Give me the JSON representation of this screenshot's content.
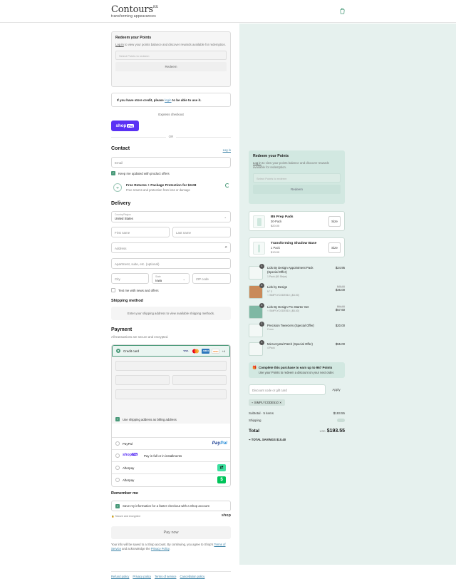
{
  "header": {
    "brand": "Contours",
    "brand_mark": "RX",
    "tagline": "transforming appearances"
  },
  "redeem": {
    "title": "Redeem your Points",
    "login_link": "Log in",
    "text": " to view your points balance and discover rewards available for redemption.",
    "placeholder": "Select Points to redeem",
    "button": "Redeem"
  },
  "store_credit": {
    "prefix": "If you have store credit, please ",
    "link": "login",
    "suffix": " to be able to use it."
  },
  "express": {
    "label": "Express checkout",
    "shop_pay": "shop",
    "shop_pay_badge": "Pay",
    "or": "OR"
  },
  "contact": {
    "heading": "Contact",
    "login": "Log in",
    "email_placeholder": "Email",
    "newsletter": "Keep me updated with product offers"
  },
  "protection": {
    "title": "Free Returns + Package Protection for $3.08",
    "subtitle": "Free returns and protection from loss or damage"
  },
  "delivery": {
    "heading": "Delivery",
    "country_label": "Country/Region",
    "country_value": "United States",
    "first_name": "First name",
    "last_name": "Last name",
    "address": "Address",
    "apartment": "Apartment, suite, etc. (optional)",
    "city": "City",
    "state_label": "State",
    "state_value": "Iowa",
    "zip": "ZIP code",
    "text_me": "Text me with news and offers"
  },
  "shipping": {
    "heading": "Shipping method",
    "note": "Enter your shipping address to view available shipping methods."
  },
  "payment": {
    "heading": "Payment",
    "sub": "All transactions are secure and encrypted.",
    "credit_card": "Credit card",
    "cards": [
      "VISA",
      "MC",
      "AMEX",
      "DISC"
    ],
    "more_cards": "+4",
    "billing": "Use shipping address as billing address",
    "methods": [
      {
        "label": "PayPal"
      },
      {
        "label": "Pay in full or in installments"
      },
      {
        "label": "Afterpay"
      },
      {
        "label": "Afterpay"
      }
    ],
    "paypal_a": "Pay",
    "paypal_b": "Pal",
    "shop_mini": "shop",
    "shop_mini_badge": "Pay"
  },
  "remember": {
    "heading": "Remember me",
    "label": "Save my information for a faster checkout with a Shop account",
    "secure": "Secure and encrypted",
    "shop": "shop"
  },
  "pay_now": "Pay now",
  "terms": {
    "text": "Your info will be saved to a Shop account. By continuing, you agree to Shop's ",
    "tos": "Terms of Service",
    "mid": " and acknowledge the ",
    "privacy": "Privacy Policy",
    "end": "."
  },
  "footer": [
    "Refund policy",
    "Privacy policy",
    "Terms of service",
    "Cancellation policy"
  ],
  "upsells": [
    {
      "name": "B5 Prep Pads",
      "variant": "30-Pack",
      "price": "$20.00",
      "button": "Size"
    },
    {
      "name": "Transforming Shadow Base",
      "variant": "1 Pack",
      "price": "$13.00",
      "button": "Size"
    }
  ],
  "line_items": [
    {
      "qty": "1",
      "name": "Lids By Design Appointment Pack (Special Offer)",
      "variant": "1 Pack (80 Strips)",
      "code": "",
      "price": "$24.95",
      "was": ""
    },
    {
      "qty": "1",
      "name": "Lids by Design",
      "variant": "N° 3",
      "code": "SIMPLYCODE510 (-$4.00)",
      "price": "$36.00",
      "was": "$40.00"
    },
    {
      "qty": "1",
      "name": "Lids By Design Pro Starter Set",
      "variant": "",
      "code": "SIMPLYCODE510 (-$6.40)",
      "price": "$57.60",
      "was": "$64.00"
    },
    {
      "qty": "1",
      "name": "Precision Tweezers (Special Offer)",
      "variant": "2 mm",
      "code": "",
      "price": "$20.00",
      "was": ""
    },
    {
      "qty": "1",
      "name": "Microcrystal Patch (Special Offer)",
      "variant": "4 Pack",
      "code": "",
      "price": "$55.00",
      "was": ""
    }
  ],
  "earn": {
    "title": "Complete this purchase to earn up to 967 Points",
    "sub": "Use your Points to redeem a discount on your next order."
  },
  "discount": {
    "placeholder": "Discount code or gift card",
    "apply": "Apply",
    "tag": "SIMPLYCODE510"
  },
  "summary": {
    "subtotal_label": "Subtotal · 5 items",
    "subtotal": "$193.55",
    "shipping_label": "Shipping",
    "total_label": "Total",
    "currency": "USD",
    "total": "$193.55",
    "savings": "TOTAL SAVINGS  $10.40"
  },
  "colors": {
    "accent": "#4a9a7a",
    "panel": "#e6f1ee",
    "shop_pay": "#5a31f4"
  }
}
